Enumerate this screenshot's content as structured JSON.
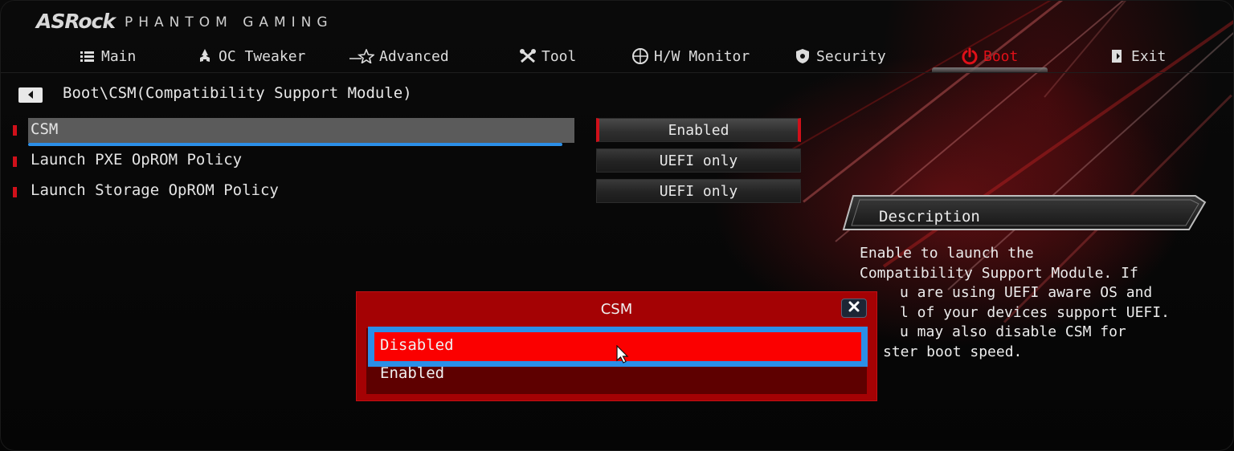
{
  "brand": {
    "logo": "ASRock",
    "subtitle": "PHANTOM GAMING"
  },
  "tabs": [
    {
      "label": "Main",
      "icon": "list-icon"
    },
    {
      "label": "OC Tweaker",
      "icon": "rocket-icon"
    },
    {
      "label": "Advanced",
      "icon": "star-icon"
    },
    {
      "label": "Tool",
      "icon": "tools-icon"
    },
    {
      "label": "H/W Monitor",
      "icon": "monitor-icon"
    },
    {
      "label": "Security",
      "icon": "shield-icon"
    },
    {
      "label": "Boot",
      "icon": "power-icon",
      "active": true
    },
    {
      "label": "Exit",
      "icon": "exit-icon"
    }
  ],
  "breadcrumb": "Boot\\CSM(Compatibility Support Module)",
  "settings": [
    {
      "label": "CSM",
      "value": "Enabled",
      "selected": true
    },
    {
      "label": "Launch PXE OpROM Policy",
      "value": "UEFI only"
    },
    {
      "label": "Launch Storage OpROM Policy",
      "value": "UEFI only"
    }
  ],
  "description": {
    "title": "Description",
    "lines": [
      "Enable to launch the",
      "Compatibility Support Module. If",
      "u are using UEFI aware OS and",
      "l of your devices support UEFI.",
      "u may also disable CSM for",
      "ster boot speed."
    ]
  },
  "popup": {
    "title": "CSM",
    "options": [
      "Disabled",
      "Enabled"
    ],
    "highlighted": "Disabled"
  },
  "colors": {
    "accent_red": "#e01018",
    "highlight_blue": "#2b8fe8",
    "popup_red": "#a40204"
  }
}
